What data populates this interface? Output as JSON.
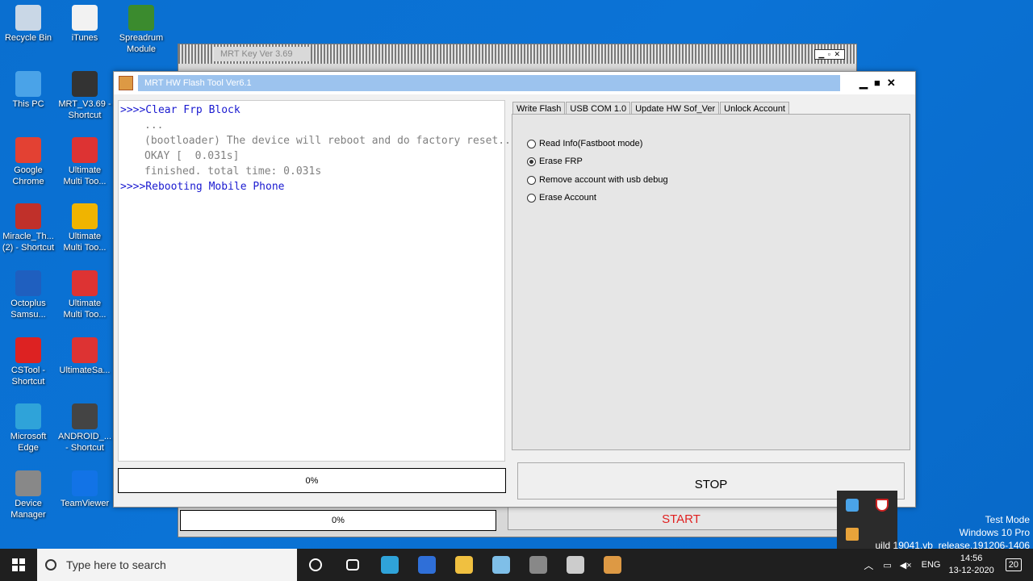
{
  "desktop": {
    "icons": [
      {
        "label": "Recycle Bin",
        "color": "#c9d7e6"
      },
      {
        "label": "iTunes",
        "color": "#f2f2f2"
      },
      {
        "label": "Spreadrum\nModule",
        "color": "#3b8b2e"
      },
      {
        "label": "This PC",
        "color": "#4aa3e8"
      },
      {
        "label": "MRT_V3.69 -\nShortcut",
        "color": "#333333"
      },
      {
        "label": "Google\nChrome",
        "color": "#e34133"
      },
      {
        "label": "Ultimate\nMulti Too...",
        "color": "#d33"
      },
      {
        "label": "Miracle_Th...\n(2) - Shortcut",
        "color": "#c0302a"
      },
      {
        "label": "Ultimate\nMulti Too...",
        "color": "#f0b400"
      },
      {
        "label": "Octoplus\nSamsu...",
        "color": "#1f5fbf"
      },
      {
        "label": "Ultimate\nMulti Too...",
        "color": "#d33"
      },
      {
        "label": "CSTool -\nShortcut",
        "color": "#d22"
      },
      {
        "label": "UltimateSa...",
        "color": "#d33"
      },
      {
        "label": "Microsoft\nEdge",
        "color": "#2fa3d9"
      },
      {
        "label": "ANDROID_...\n- Shortcut",
        "color": "#444"
      },
      {
        "label": "Device\nManager",
        "color": "#888"
      },
      {
        "label": "TeamViewer",
        "color": "#1273e6"
      }
    ]
  },
  "back_window": {
    "title": "MRT Key Ver 3.69",
    "controls": "▁ ▫ ✕",
    "progress_text": "0%",
    "start_label": "START"
  },
  "front_window": {
    "title": "MRT HW Flash Tool Ver6.1",
    "controls": {
      "minimize": "▁",
      "maximize": "■",
      "close": "✕"
    },
    "log_lines": [
      {
        "text": ">>>>Clear Frp Block",
        "style": "blue"
      },
      {
        "text": "...",
        "style": "gray"
      },
      {
        "text": "(bootloader) The device will reboot and do factory reset...",
        "style": "gray"
      },
      {
        "text": "OKAY [  0.031s]",
        "style": "gray"
      },
      {
        "text": "finished. total time: 0.031s",
        "style": "gray"
      },
      {
        "text": ">>>>Rebooting Mobile Phone",
        "style": "blue"
      }
    ],
    "progress_text": "0%",
    "tabs": [
      "Write Flash",
      "USB COM 1.0",
      "Update HW Sof_Ver",
      "Unlock Account"
    ],
    "options": [
      {
        "label": "Read Info(Fastboot mode)",
        "checked": false
      },
      {
        "label": "Erase FRP",
        "checked": true
      },
      {
        "label": "Remove account with usb debug",
        "checked": false
      },
      {
        "label": "Erase Account",
        "checked": false
      }
    ],
    "stop_label": "STOP"
  },
  "watermark": {
    "line1": "Test Mode",
    "line2": "Windows 10 Pro",
    "line3": "uild 19041.vb_release.191206-1406"
  },
  "taskbar": {
    "search_placeholder": "Type here to search",
    "apps": [
      "cortana-icon",
      "task-view-icon",
      "edge-icon",
      "store-icon",
      "file-explorer-icon",
      "notepad-icon",
      "app-icon",
      "mrt-icon",
      "tool-icon"
    ],
    "language": "ENG",
    "time": "14:56",
    "date": "13-12-2020",
    "notifications": "20"
  }
}
